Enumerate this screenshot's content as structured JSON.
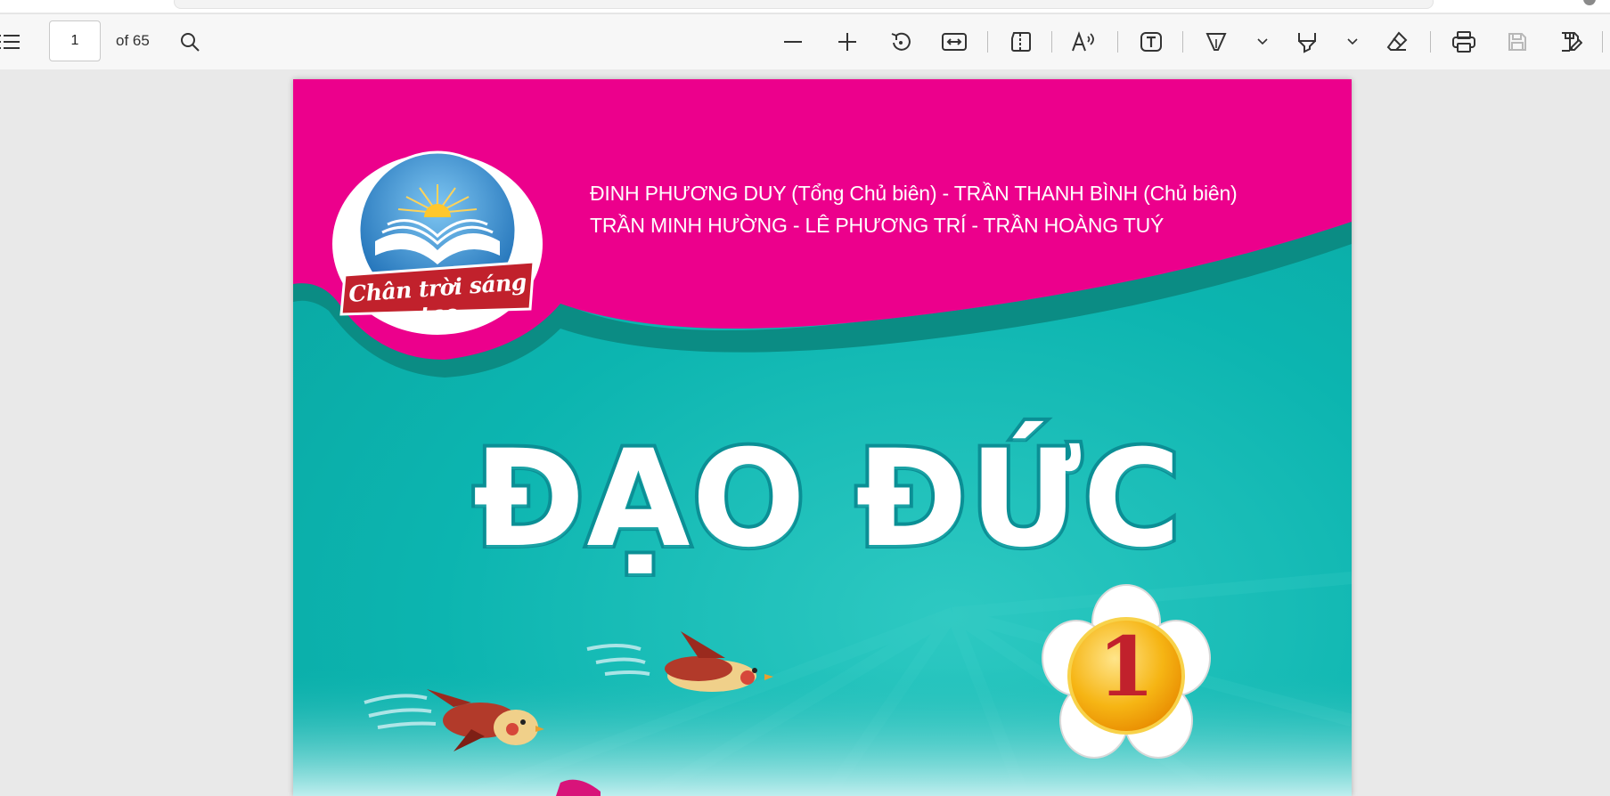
{
  "toolbar": {
    "page_number": "1",
    "page_total_label": "of 65",
    "icons": {
      "contents": "contents-icon",
      "search": "search-icon",
      "zoom_out": "zoom-out-icon",
      "zoom_in": "zoom-in-icon",
      "rotate": "rotate-icon",
      "fit_width": "fit-width-icon",
      "page_view": "page-view-icon",
      "read_aloud": "read-aloud-icon",
      "text_box": "text-box-icon",
      "draw": "draw-icon",
      "highlight": "highlight-icon",
      "erase": "eraser-icon",
      "print": "print-icon",
      "save": "save-icon",
      "save_as": "save-as-icon"
    }
  },
  "document": {
    "authors_line1": "ĐINH PHƯƠNG DUY (Tổng Chủ biên) - TRẦN THANH BÌNH (Chủ biên)",
    "authors_line2": "TRẦN MINH HƯỜNG - LÊ PHƯƠNG TRÍ - TRẦN HOÀNG TUÝ",
    "publisher_logo_text": "Chân trời sáng tạo",
    "title": "ĐẠO ĐỨC",
    "grade": "1",
    "colors": {
      "pink_header": "#ec008c",
      "teal_background": "#0cb5b0",
      "dark_teal_band": "#0b8c84",
      "logo_blue": "#1e7fc4",
      "ribbon_red": "#c1212c",
      "badge_yellow": "#f6b514"
    }
  }
}
